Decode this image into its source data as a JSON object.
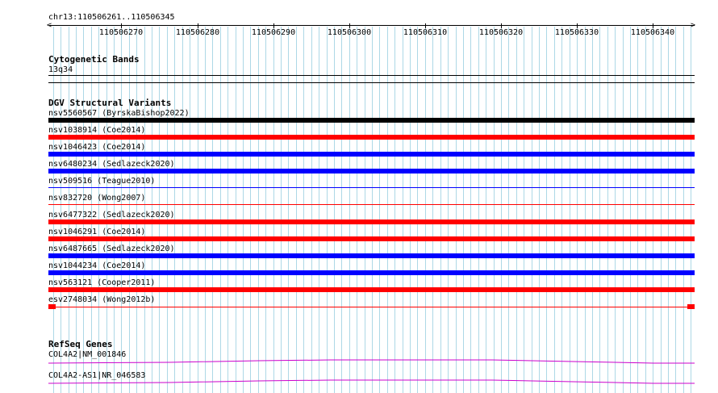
{
  "ruler": {
    "location": "chr13:110506261..110506345",
    "start": 110506261,
    "end": 110506345,
    "tick_labels": [
      "110506270",
      "110506280",
      "110506290",
      "110506300",
      "110506310",
      "110506320",
      "110506330",
      "110506340"
    ]
  },
  "tracks": {
    "cytoband": {
      "title": "Cytogenetic Bands",
      "band": "13q34"
    },
    "dgv": {
      "title": "DGV Structural Variants",
      "variants": [
        {
          "label": "nsv5560567 (ByrskaBishop2022)",
          "color": "#000000",
          "style": "thick"
        },
        {
          "label": "nsv1038914 (Coe2014)",
          "color": "#ff0000",
          "style": "thick"
        },
        {
          "label": "nsv1046423 (Coe2014)",
          "color": "#0000ff",
          "style": "thick"
        },
        {
          "label": "nsv6480234 (Sedlazeck2020)",
          "color": "#0000ff",
          "style": "thick"
        },
        {
          "label": "nsv509516 (Teague2010)",
          "color": "#0000ff",
          "style": "thin"
        },
        {
          "label": "nsv832720 (Wong2007)",
          "color": "#ff0000",
          "style": "thin"
        },
        {
          "label": "nsv6477322 (Sedlazeck2020)",
          "color": "#ff0000",
          "style": "thick"
        },
        {
          "label": "nsv1046291 (Coe2014)",
          "color": "#ff0000",
          "style": "thick"
        },
        {
          "label": "nsv6487665 (Sedlazeck2020)",
          "color": "#0000ff",
          "style": "thick"
        },
        {
          "label": "nsv1044234 (Coe2014)",
          "color": "#0000ff",
          "style": "thick"
        },
        {
          "label": "nsv563121 (Cooper2011)",
          "color": "#ff0000",
          "style": "thick"
        },
        {
          "label": "esv2748034 (Wong2012b)",
          "color": "#ff0000",
          "style": "ends"
        }
      ]
    },
    "refseq": {
      "title": "RefSeq Genes",
      "genes": [
        {
          "label": "COL4A2|NM_001846",
          "color": "#cc00cc"
        },
        {
          "label": "COL4A2-AS1|NR_046583",
          "color": "#cc00cc"
        }
      ]
    }
  },
  "colors": {
    "grid": "#add8e6",
    "accent_red": "#ff0000",
    "accent_blue": "#0000ff",
    "gene_magenta": "#cc00cc"
  }
}
